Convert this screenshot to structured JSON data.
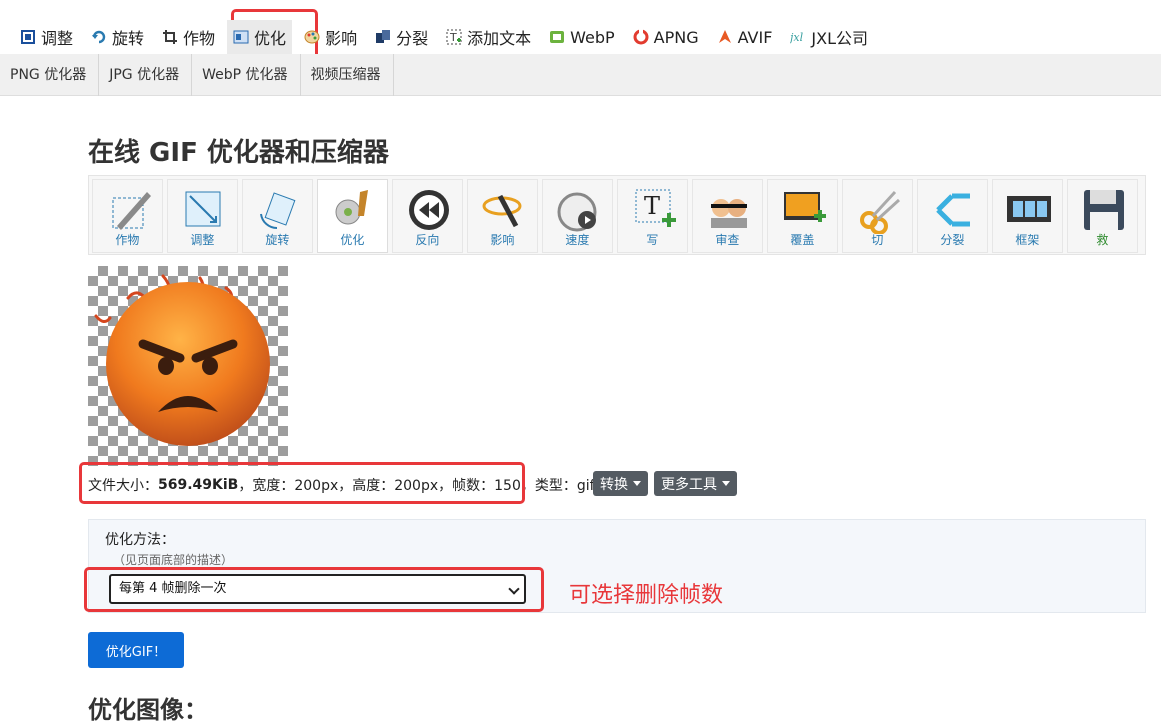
{
  "top_nav": [
    {
      "label": "调整",
      "icon": "crop-icon",
      "color": "#1a4f9c"
    },
    {
      "label": "旋转",
      "icon": "rotate-icon",
      "color": "#2a7ab0"
    },
    {
      "label": "作物",
      "icon": "crop-frame-icon",
      "color": "#3a3a3a"
    },
    {
      "label": "优化",
      "icon": "optimize-icon",
      "color": "#2a6ab0",
      "active": true
    },
    {
      "label": "影响",
      "icon": "palette-icon",
      "color": "#c4842a"
    },
    {
      "label": "分裂",
      "icon": "split-icon",
      "color": "#1f3b66"
    },
    {
      "label": "添加文本",
      "icon": "add-text-icon",
      "color": "#444"
    },
    {
      "label": "WebP",
      "icon": "webp-icon",
      "color": "#6cb33e"
    },
    {
      "label": "APNG",
      "icon": "apng-icon",
      "color": "#e23b2f"
    },
    {
      "label": "AVIF",
      "icon": "avif-icon",
      "color": "#e85a24"
    },
    {
      "label": "JXL公司",
      "icon": "jxl-icon",
      "color": "#3aa0a0"
    }
  ],
  "sub_nav": [
    "PNG 优化器",
    "JPG 优化器",
    "WebP 优化器",
    "视频压缩器"
  ],
  "page_title": "在线 GIF 优化器和压缩器",
  "tools": [
    {
      "label": "作物",
      "icon": "crop-tool-icon"
    },
    {
      "label": "调整",
      "icon": "resize-tool-icon"
    },
    {
      "label": "旋转",
      "icon": "rotate-tool-icon"
    },
    {
      "label": "优化",
      "icon": "broom-tool-icon",
      "active": true
    },
    {
      "label": "反向",
      "icon": "reverse-tool-icon"
    },
    {
      "label": "影响",
      "icon": "magic-wand-tool-icon"
    },
    {
      "label": "速度",
      "icon": "stopwatch-tool-icon"
    },
    {
      "label": "写",
      "icon": "text-tool-icon"
    },
    {
      "label": "审查",
      "icon": "censor-tool-icon"
    },
    {
      "label": "覆盖",
      "icon": "overlay-tool-icon"
    },
    {
      "label": "切",
      "icon": "scissors-tool-icon"
    },
    {
      "label": "分裂",
      "icon": "split-tool-icon"
    },
    {
      "label": "框架",
      "icon": "film-frames-tool-icon"
    },
    {
      "label": "救",
      "icon": "save-floppy-tool-icon",
      "green": true
    }
  ],
  "file_info": {
    "size_label": "文件大小：",
    "size_value": "569.49KiB",
    "rest": "，宽度：200px，高度：200px，帧数：150，",
    "type_text": "类型：gif"
  },
  "convert_button": "转换",
  "more_tools_button": "更多工具",
  "optimize_panel": {
    "label": "优化方法：",
    "desc": "（见页面底部的描述）",
    "selected": "每第 4 帧删除一次"
  },
  "annotation": "可选择删除帧数",
  "submit_button": "优化GIF！",
  "section_title": "优化图像："
}
